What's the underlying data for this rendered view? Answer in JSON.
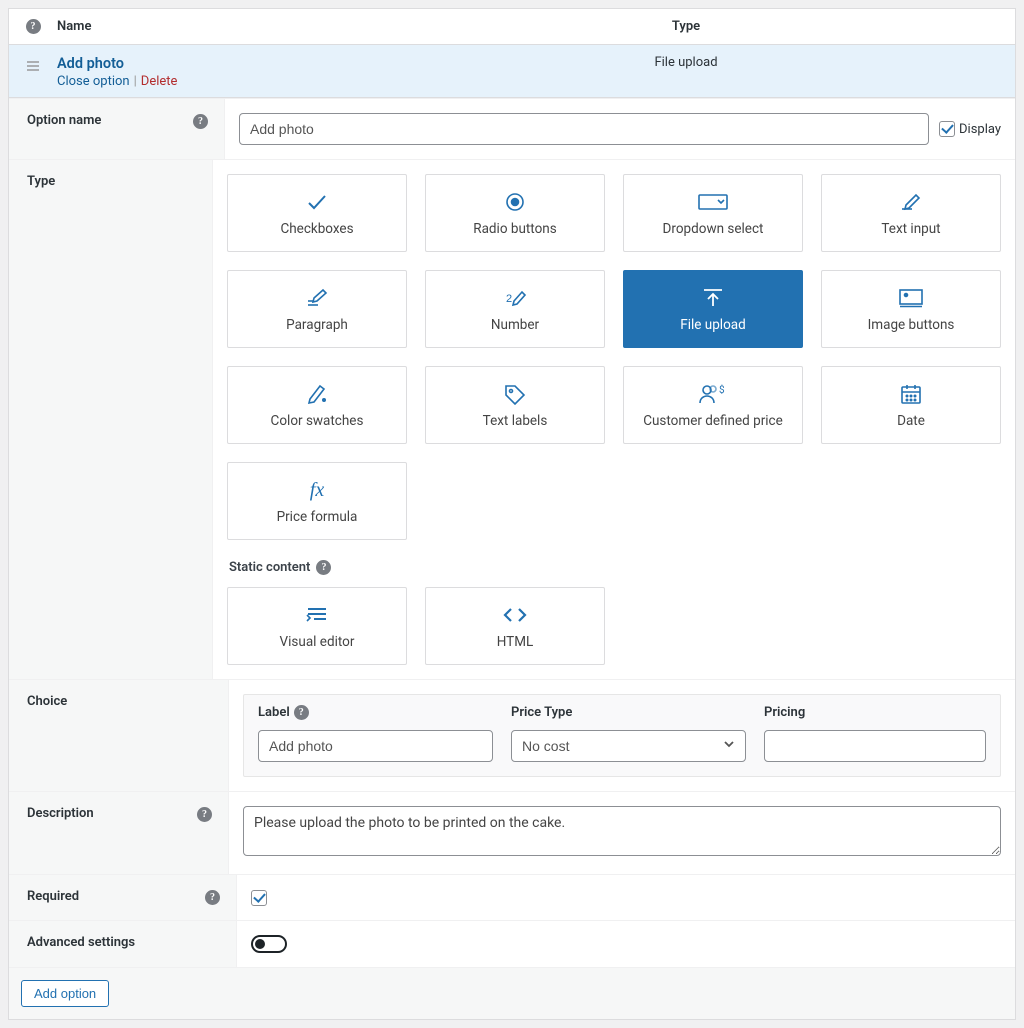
{
  "columns": {
    "name": "Name",
    "type": "Type"
  },
  "option": {
    "title": "Add photo",
    "close_label": "Close option",
    "delete_label": "Delete",
    "type_display": "File upload"
  },
  "fields": {
    "option_name": {
      "label": "Option name",
      "value": "Add photo",
      "display_label": "Display",
      "display_checked": true
    },
    "type": {
      "label": "Type"
    },
    "choice": {
      "label": "Choice",
      "headers": {
        "label": "Label",
        "price_type": "Price Type",
        "pricing": "Pricing"
      },
      "row": {
        "label_value": "Add photo",
        "price_type_value": "No cost",
        "pricing_value": ""
      }
    },
    "description": {
      "label": "Description",
      "value": "Please upload the photo to be printed on the cake."
    },
    "required": {
      "label": "Required",
      "checked": true
    },
    "advanced": {
      "label": "Advanced settings",
      "on": false
    }
  },
  "type_cards": {
    "checkboxes": "Checkboxes",
    "radio": "Radio buttons",
    "dropdown": "Dropdown select",
    "text_input": "Text input",
    "paragraph": "Paragraph",
    "number": "Number",
    "file_upload": "File upload",
    "image_buttons": "Image buttons",
    "color_swatches": "Color swatches",
    "text_labels": "Text labels",
    "customer_price": "Customer defined price",
    "date": "Date",
    "price_formula": "Price formula"
  },
  "static_content_label": "Static content",
  "static_cards": {
    "visual_editor": "Visual editor",
    "html": "HTML"
  },
  "add_option_label": "Add option"
}
